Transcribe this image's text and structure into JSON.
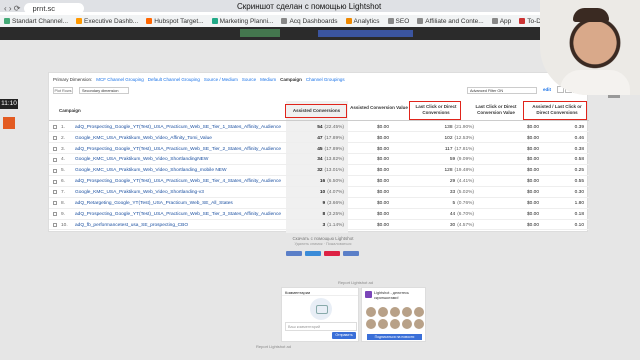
{
  "browser": {
    "url": "prnt.sc",
    "page_title": "Скриншот сделан с помощью Lightshot",
    "bookmarks": [
      {
        "label": "Standart Channel...",
        "color": "#4a7"
      },
      {
        "label": "Executive Dashb...",
        "color": "#f90"
      },
      {
        "label": "Hubspot Target...",
        "color": "#f60"
      },
      {
        "label": "Marketing Planni...",
        "color": "#2a8"
      },
      {
        "label": "Acq Dashboards",
        "color": "#888"
      },
      {
        "label": "Analytics",
        "color": "#e80"
      },
      {
        "label": "SEO",
        "color": "#888"
      },
      {
        "label": "Affiliate and Conte...",
        "color": "#888"
      },
      {
        "label": "App",
        "color": "#888"
      },
      {
        "label": "To-Do List",
        "color": "#c33"
      }
    ]
  },
  "recorder": {
    "time": "11:10"
  },
  "report": {
    "primary_dimension_label": "Primary Dimension:",
    "dimensions": [
      "MCF Channel Grouping",
      "Default Channel Grouping",
      "Source / Medium",
      "Source",
      "Medium",
      "Campaign",
      "Channel Groupings"
    ],
    "plot_rows": "Plot Rows",
    "secondary_dimension": "Secondary dimension",
    "advanced_filter": "Advanced Filter ON",
    "edit": "edit",
    "columns": {
      "campaign": "Campaign",
      "assisted": "Assisted Conversions",
      "assisted_value": "Assisted Conversion Value",
      "last_click": "Last Click or Direct Conversions",
      "last_click_value": "Last Click or Direct Conversion Value",
      "ratio": "Assisted / Last Click or Direct Conversions"
    },
    "rows": [
      {
        "n": "1.",
        "name": "adQ_Prospecting_Google_YT(Test)_USA_Practicum_Web_SE_Tier_1_States_Affinity_Audience",
        "assisted": "54",
        "assisted_pct": "(22.45%)",
        "assisted_value": "$0.00",
        "assisted_value_pct": "(0.00%)",
        "last": "138",
        "last_pct": "(21.90%)",
        "last_value": "$0.00",
        "last_value_pct": "(0.00%)",
        "ratio": "0.39"
      },
      {
        "n": "2.",
        "name": "Google_KMC_USA_Praktikum_Web_Video_Affinity_Tomi_Value",
        "assisted": "47",
        "assisted_pct": "(17.89%)",
        "assisted_value": "$0.00",
        "assisted_value_pct": "(0.00%)",
        "last": "102",
        "last_pct": "(12.53%)",
        "last_value": "$0.00",
        "last_value_pct": "(0.00%)",
        "ratio": "0.46"
      },
      {
        "n": "3.",
        "name": "adQ_Prospecting_Google_YT(Test)_USA_Practicum_Web_SE_Tier_2_States_Affinity_Audience",
        "assisted": "45",
        "assisted_pct": "(17.89%)",
        "assisted_value": "$0.00",
        "assisted_value_pct": "(0.00%)",
        "last": "117",
        "last_pct": "(17.81%)",
        "last_value": "$0.00",
        "last_value_pct": "(0.00%)",
        "ratio": "0.38"
      },
      {
        "n": "4.",
        "name": "Google_KMC_USA_Praktikum_Web_Video_ShortlandingNEW",
        "assisted": "34",
        "assisted_pct": "(13.82%)",
        "assisted_value": "$0.00",
        "assisted_value_pct": "(0.00%)",
        "last": "59",
        "last_pct": "(9.09%)",
        "last_value": "$0.00",
        "last_value_pct": "(0.00%)",
        "ratio": "0.58"
      },
      {
        "n": "5.",
        "name": "Google_KMC_USA_Praktikum_Web_Video_Shortlanding_mobile NEW",
        "assisted": "32",
        "assisted_pct": "(13.01%)",
        "assisted_value": "$0.00",
        "assisted_value_pct": "(0.00%)",
        "last": "128",
        "last_pct": "(19.48%)",
        "last_value": "$0.00",
        "last_value_pct": "(0.00%)",
        "ratio": "0.25"
      },
      {
        "n": "6.",
        "name": "adQ_Prospecting_Google_YT(Test)_USA_Practicum_Web_SE_Tier_4_States_Affinity_Audience",
        "assisted": "16",
        "assisted_pct": "(6.50%)",
        "assisted_value": "$0.00",
        "assisted_value_pct": "(0.00%)",
        "last": "29",
        "last_pct": "(4.41%)",
        "last_value": "$0.00",
        "last_value_pct": "(0.00%)",
        "ratio": "0.55"
      },
      {
        "n": "7.",
        "name": "Google_KMC_USA_Praktikum_Web_Video_Shortlanding-v3",
        "assisted": "10",
        "assisted_pct": "(4.07%)",
        "assisted_value": "$0.00",
        "assisted_value_pct": "(0.00%)",
        "last": "33",
        "last_pct": "(5.02%)",
        "last_value": "$0.00",
        "last_value_pct": "(0.00%)",
        "ratio": "0.30"
      },
      {
        "n": "8.",
        "name": "adQ_Retargeting_Google_YT(Test)_USA_Practicum_Web_SE_All_States",
        "assisted": "9",
        "assisted_pct": "(3.66%)",
        "assisted_value": "$0.00",
        "assisted_value_pct": "(0.00%)",
        "last": "5",
        "last_pct": "(0.76%)",
        "last_value": "$0.00",
        "last_value_pct": "(0.00%)",
        "ratio": "1.80"
      },
      {
        "n": "9.",
        "name": "adQ_Prospecting_Google_YT(Test)_USA_Practicum_Web_SE_Tier_3_States_Affinity_Audience",
        "assisted": "8",
        "assisted_pct": "(3.25%)",
        "assisted_value": "$0.00",
        "assisted_value_pct": "(0.00%)",
        "last": "44",
        "last_pct": "(6.70%)",
        "last_value": "$0.00",
        "last_value_pct": "(0.00%)",
        "ratio": "0.18"
      },
      {
        "n": "10.",
        "name": "adQ_fb_performancetest_usa_SE_prospecting_CBO",
        "assisted": "3",
        "assisted_pct": "(1.14%)",
        "assisted_value": "$0.00",
        "assisted_value_pct": "(0.00%)",
        "last": "30",
        "last_pct": "(4.57%)",
        "last_value": "$0.00",
        "last_value_pct": "(0.00%)",
        "ratio": "0.10"
      }
    ]
  },
  "lightshot": {
    "footer_note": "Скачать с помощью Lightshot",
    "footer_sub": "Удалить снимок · Пожаловаться",
    "widget_chat_title": "Комментарии",
    "widget_chat_placeholder": "Ваш комментарий",
    "widget_chat_send": "Отправить",
    "widget_promo_text": "Lightshot - делитесь скриншотами!",
    "widget_promo_button": "Подписаться на новости",
    "foot_link": "Report Lightshot ad",
    "foot_link2": "Report Lightshot ad"
  }
}
